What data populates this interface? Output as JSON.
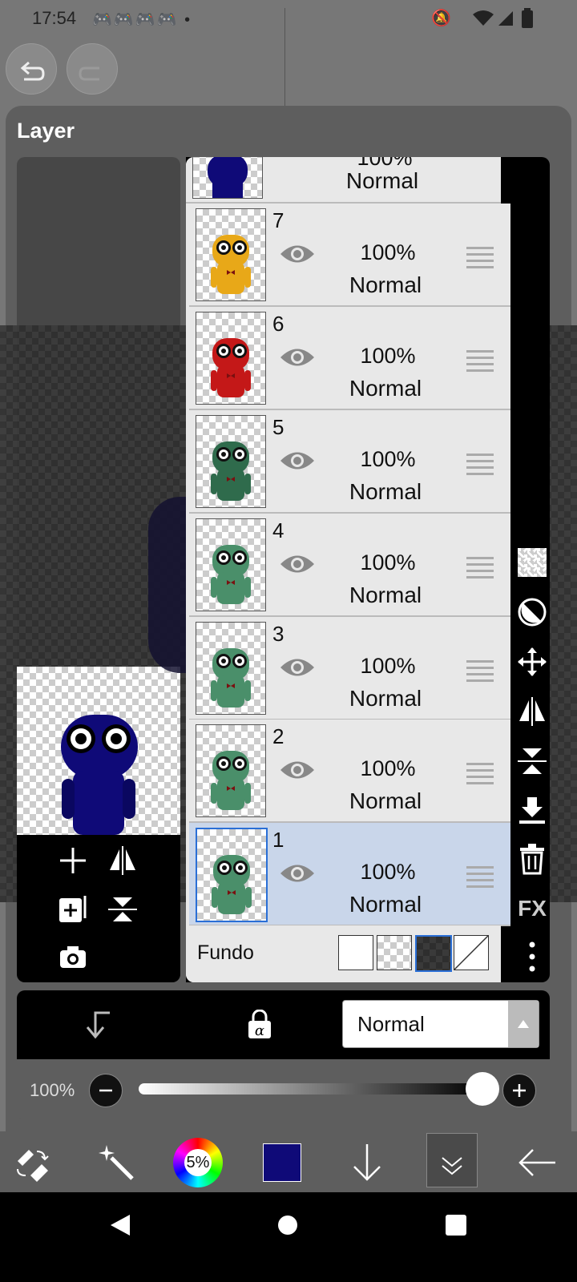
{
  "status": {
    "time": "17:54"
  },
  "panel": {
    "title": "Layer"
  },
  "layers": [
    {
      "num": "7",
      "opacity": "100%",
      "mode": "Normal",
      "color": "#e8a818",
      "eyeColor": "#e8a818"
    },
    {
      "num": "6",
      "opacity": "100%",
      "mode": "Normal",
      "color": "#c41818",
      "eyeColor": "#c41818"
    },
    {
      "num": "5",
      "opacity": "100%",
      "mode": "Normal",
      "color": "#2f6b4c",
      "eyeColor": "#2f6b4c"
    },
    {
      "num": "4",
      "opacity": "100%",
      "mode": "Normal",
      "color": "#4a8f6a",
      "eyeColor": "#4a8f6a"
    },
    {
      "num": "3",
      "opacity": "100%",
      "mode": "Normal",
      "color": "#4a8f6a",
      "eyeColor": "#4a8f6a"
    },
    {
      "num": "2",
      "opacity": "100%",
      "mode": "Normal",
      "color": "#4a8f6a",
      "eyeColor": "#4a8f6a"
    },
    {
      "num": "1",
      "opacity": "100%",
      "mode": "Normal",
      "color": "#4a8f6a",
      "eyeColor": "#4a8f6a"
    }
  ],
  "top_partial": {
    "opacity": "100%",
    "mode": "Normal"
  },
  "fundo": {
    "label": "Fundo"
  },
  "blend": {
    "value": "Normal"
  },
  "opacity_slider": {
    "label": "100%",
    "value": 1.0
  },
  "sidebar_tools": [
    "checker-icon",
    "circle-slash-icon",
    "move-icon",
    "flip-horizontal-icon",
    "flip-vertical-icon",
    "merge-down-icon",
    "trash-icon",
    "fx-icon",
    "more-icon"
  ],
  "fx_label": "FX",
  "bottom": {
    "color_pct": "5%",
    "current_color": "#0f0a78"
  },
  "colors": {
    "character_blue": "#0f0a78",
    "selected": "#c9d6ea",
    "accent": "#2a6fd6"
  }
}
